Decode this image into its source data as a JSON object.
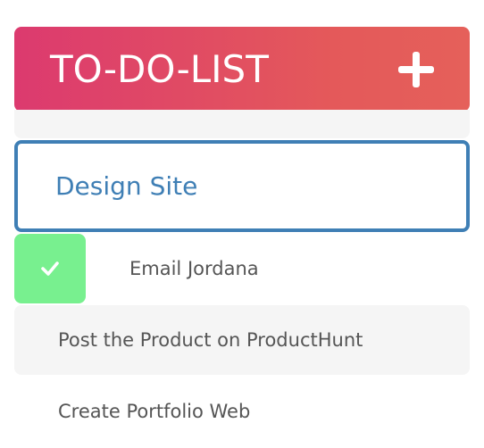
{
  "header": {
    "title": "TO-DO-LIST",
    "add_icon": "plus-icon"
  },
  "input": {
    "value": "Design Site"
  },
  "tasks": [
    {
      "label": "Email Jordana",
      "completed": true,
      "check_icon": "checkmark-icon"
    },
    {
      "label": "Post the Product on ProductHunt",
      "completed": false
    },
    {
      "label": "Create Portfolio Web",
      "completed": false
    }
  ],
  "colors": {
    "header_gradient_start": "#dc3a6f",
    "header_gradient_end": "#e5605a",
    "input_border": "#3f7fb5",
    "input_text": "#3f7fb5",
    "check_green": "#78f08f",
    "row_shade": "#f5f5f5",
    "task_text": "#555555"
  }
}
